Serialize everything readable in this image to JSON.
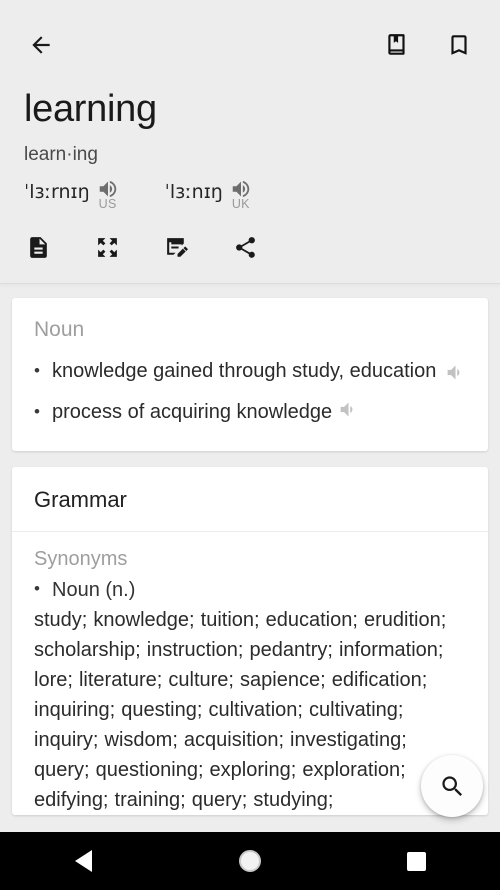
{
  "header": {
    "back_icon": "arrow-left-icon",
    "library_icon": "book-bookmark-icon",
    "bookmark_icon": "bookmark-outline-icon",
    "word": "learning",
    "syllables": "learn·ing",
    "pronunciations": [
      {
        "ipa": "ˈlɜːrnɪŋ",
        "locale": "US",
        "icon": "speaker-icon"
      },
      {
        "ipa": "ˈlɜːnɪŋ",
        "locale": "UK",
        "icon": "speaker-icon"
      }
    ],
    "actions": [
      {
        "name": "article-icon",
        "label": "Article"
      },
      {
        "name": "fullscreen-icon",
        "label": "Fullscreen"
      },
      {
        "name": "edit-note-icon",
        "label": "Edit note"
      },
      {
        "name": "share-icon",
        "label": "Share"
      }
    ]
  },
  "definition_card": {
    "pos": "Noun",
    "bullet": "•",
    "entries": [
      {
        "text": "knowledge gained through study, education",
        "speaker": "speaker-icon"
      },
      {
        "text": "process of acquiring knowledge",
        "speaker": "speaker-icon"
      }
    ]
  },
  "grammar_card": {
    "title": "Grammar",
    "synonyms_label": "Synonyms",
    "bullet": "•",
    "pos": "Noun (n.)",
    "words": "study; knowledge; tuition; education; erudition; scholarship; instruction; pedantry; information; lore; literature; culture; sapience; edification; inquiring; questing; cultivation; cultivating; inquiry; wisdom; acquisition; investigating; query; questioning; exploring; exploration; edifying; training; query; studying;"
  },
  "fab": {
    "icon": "search-icon",
    "label": "Search"
  },
  "navbar": {
    "back": "nav-back-icon",
    "home": "nav-home-icon",
    "recents": "nav-recents-icon"
  }
}
